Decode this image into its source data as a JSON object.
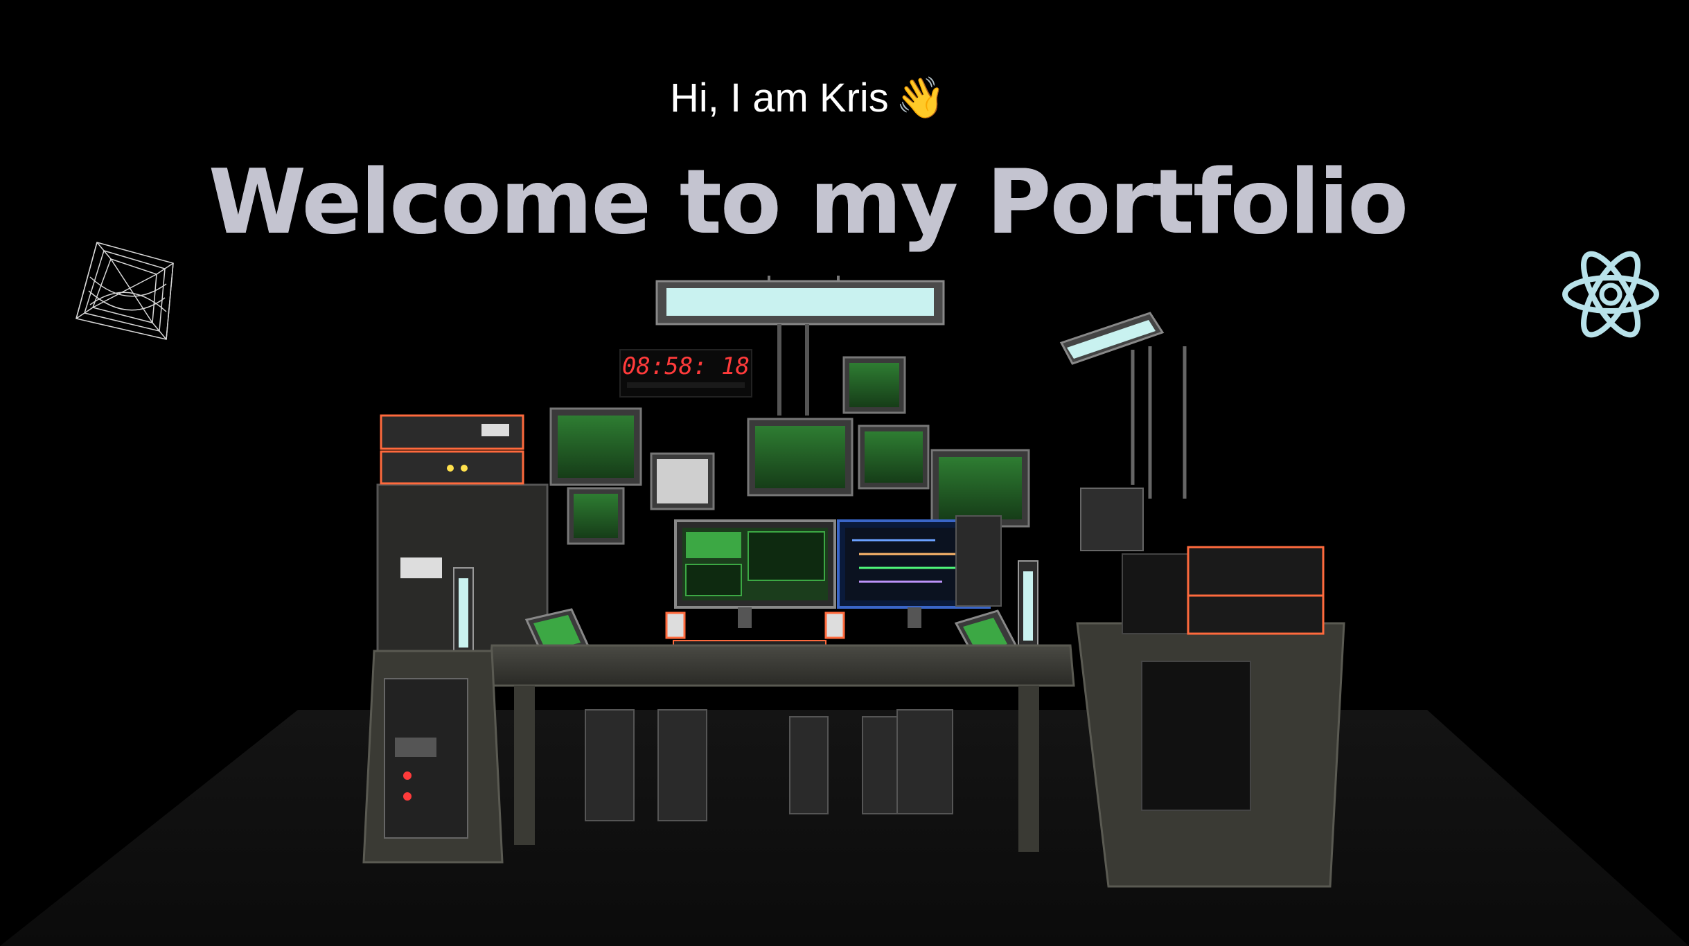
{
  "hero": {
    "greeting": "Hi, I am Kris",
    "wave_emoji": "👋",
    "title": "Welcome to my Portfolio"
  },
  "scene": {
    "clock_display": "08:58: 18",
    "floating_icons": [
      "wireframe-cube-icon",
      "react-logo-icon"
    ],
    "colors": {
      "background": "#000000",
      "title": "#c5c5d3",
      "screen_green": "#39d353",
      "react_blue": "#b8e2ea",
      "clock_red": "#ff3b3b"
    }
  }
}
